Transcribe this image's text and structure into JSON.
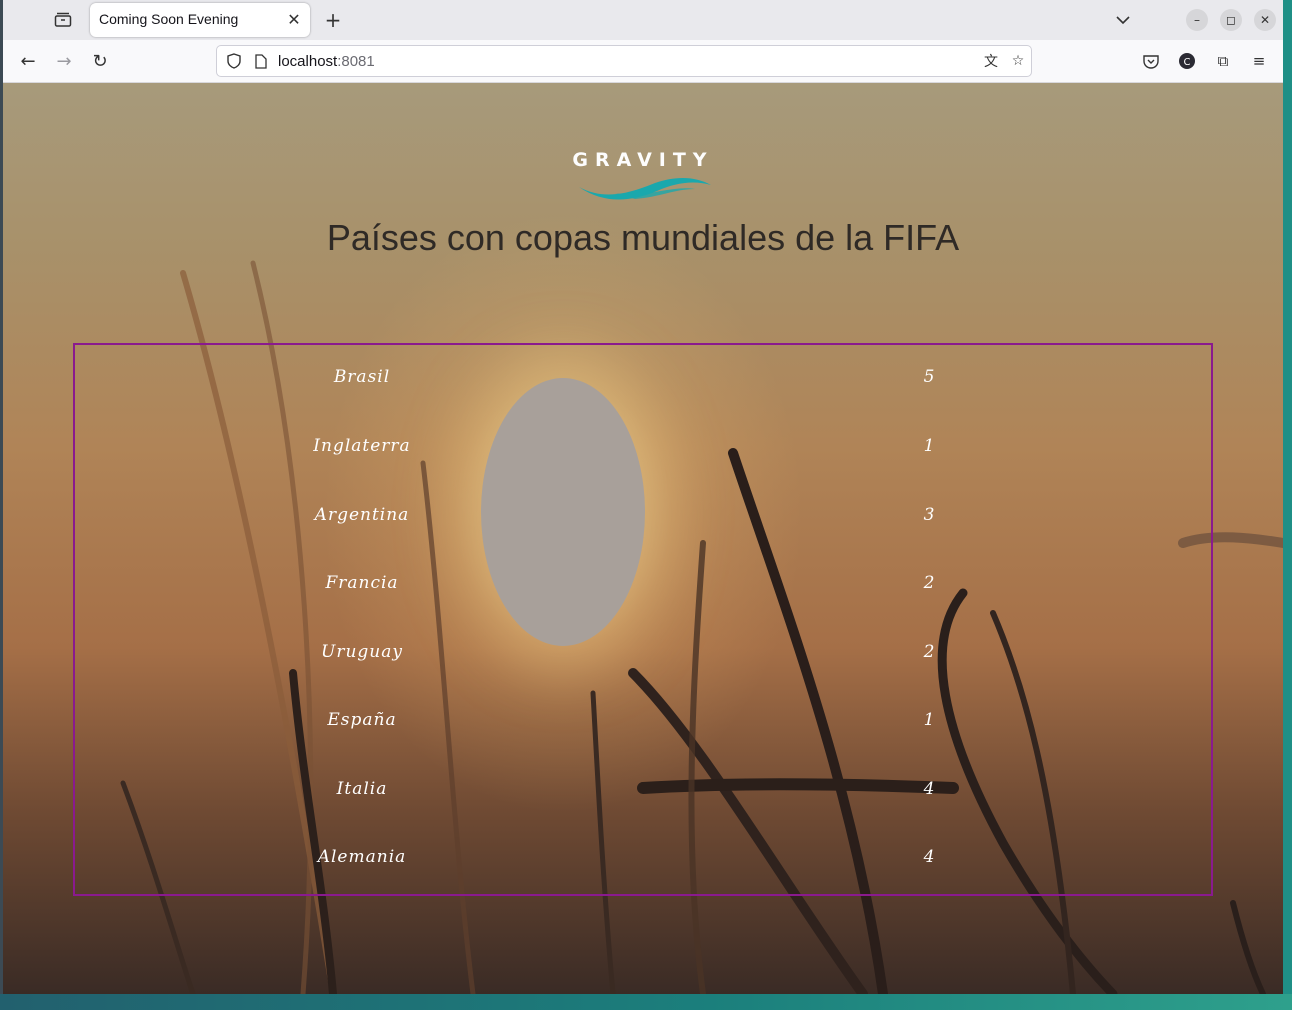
{
  "browser": {
    "tab_title": "Coming Soon Evening",
    "url_host": "localhost",
    "url_port": ":8081"
  },
  "page": {
    "logo_text": "GRAVITY",
    "title": "Países con copas mundiales de la FIFA",
    "rows": [
      {
        "country": "Brasil",
        "cups": "5"
      },
      {
        "country": "Inglaterra",
        "cups": "1"
      },
      {
        "country": "Argentina",
        "cups": "3"
      },
      {
        "country": "Francia",
        "cups": "2"
      },
      {
        "country": "Uruguay",
        "cups": "2"
      },
      {
        "country": "España",
        "cups": "1"
      },
      {
        "country": "Italia",
        "cups": "4"
      },
      {
        "country": "Alemania",
        "cups": "4"
      }
    ]
  }
}
